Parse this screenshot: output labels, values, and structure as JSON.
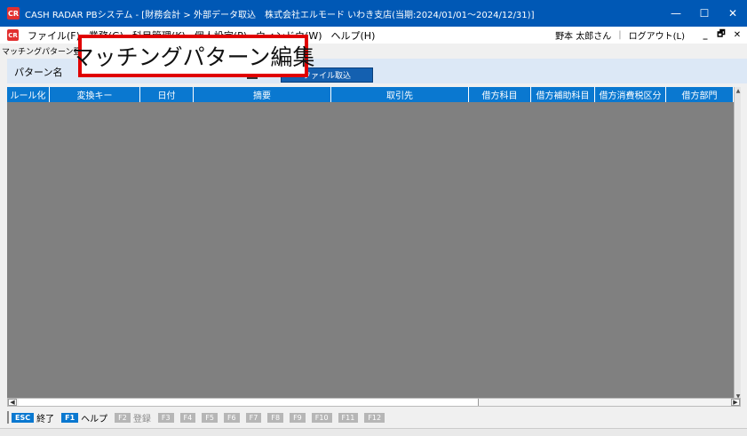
{
  "titlebar": {
    "logo_text": "CR",
    "title": "CASH RADAR PBシステム - [財務会計 > 外部データ取込　株式会社エルモード いわき支店(当期:2024/01/01〜2024/12/31)]",
    "minimize": "—",
    "maximize": "☐",
    "close": "✕"
  },
  "menubar": {
    "logo_text": "CR",
    "items": [
      "ファイル(F)",
      "業務(G)",
      "科目管理(K)",
      "個人設定(P)",
      "ウィンドウ(W)",
      "ヘルプ(H)"
    ],
    "user": "野本 太郎さん",
    "separator": "|",
    "logout": "ログアウト(L)",
    "mini_min": "_",
    "mini_restore": "🗗",
    "mini_close": "✕"
  },
  "subwindow": {
    "label": "マッチングパターン登録"
  },
  "toolbar": {
    "pattern_label": "パターン名",
    "import_button": "ファイル取込"
  },
  "callout": {
    "text": "マッチングパターン編集"
  },
  "grid": {
    "columns": [
      {
        "label": "ルール化"
      },
      {
        "label": "変換キー"
      },
      {
        "label": "日付"
      },
      {
        "label": "摘要"
      },
      {
        "label": "取引先"
      },
      {
        "label": "借方科目"
      },
      {
        "label": "借方補助科目"
      },
      {
        "label": "借方消費税区分"
      },
      {
        "label": "借方部門"
      }
    ]
  },
  "fkeys": [
    {
      "badge": "ESC",
      "label": "終了",
      "enabled": true
    },
    {
      "badge": "F1",
      "label": "ヘルプ",
      "enabled": true
    },
    {
      "badge": "F2",
      "label": "登録",
      "enabled": false
    },
    {
      "badge": "F3",
      "label": "",
      "enabled": false
    },
    {
      "badge": "F4",
      "label": "",
      "enabled": false
    },
    {
      "badge": "F5",
      "label": "",
      "enabled": false
    },
    {
      "badge": "F6",
      "label": "",
      "enabled": false
    },
    {
      "badge": "F7",
      "label": "",
      "enabled": false
    },
    {
      "badge": "F8",
      "label": "",
      "enabled": false
    },
    {
      "badge": "F9",
      "label": "",
      "enabled": false
    },
    {
      "badge": "F10",
      "label": "",
      "enabled": false
    },
    {
      "badge": "F11",
      "label": "",
      "enabled": false
    },
    {
      "badge": "F12",
      "label": "",
      "enabled": false
    }
  ],
  "colors": {
    "titlebar": "#0058b5",
    "header": "#0a78d0",
    "grid_bg": "#808080",
    "callout_border": "#e00000"
  }
}
